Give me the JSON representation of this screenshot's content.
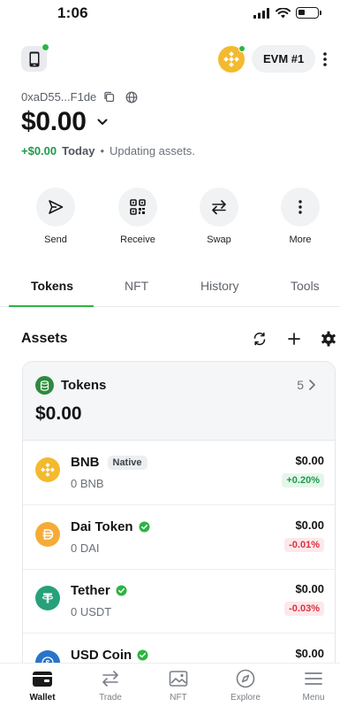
{
  "status_bar": {
    "time": "1:06"
  },
  "header": {
    "network_label": "EVM #1"
  },
  "account": {
    "address": "0xaD55...F1de",
    "balance": "$0.00",
    "change_value": "+$0.00",
    "change_period": "Today",
    "status_text": "Updating assets."
  },
  "actions": [
    {
      "label": "Send",
      "icon": "send-icon"
    },
    {
      "label": "Receive",
      "icon": "qr-code-icon"
    },
    {
      "label": "Swap",
      "icon": "swap-icon"
    },
    {
      "label": "More",
      "icon": "more-vertical-icon"
    }
  ],
  "tabs": [
    {
      "label": "Tokens",
      "active": true
    },
    {
      "label": "NFT",
      "active": false
    },
    {
      "label": "History",
      "active": false
    },
    {
      "label": "Tools",
      "active": false
    }
  ],
  "assets": {
    "title": "Assets",
    "group": {
      "title": "Tokens",
      "count": "5",
      "total": "$0.00"
    },
    "tokens": [
      {
        "name": "BNB",
        "badge": "Native",
        "amount": "0 BNB",
        "value": "$0.00",
        "change": "+0.20%",
        "trend": "up",
        "color": "#f3ba2f"
      },
      {
        "name": "Dai Token",
        "verified": true,
        "amount": "0 DAI",
        "value": "$0.00",
        "change": "-0.01%",
        "trend": "down",
        "color": "#f5ac37"
      },
      {
        "name": "Tether",
        "verified": true,
        "amount": "0 USDT",
        "value": "$0.00",
        "change": "-0.03%",
        "trend": "down",
        "color": "#26a17b"
      },
      {
        "name": "USD Coin",
        "verified": true,
        "value": "$0.00",
        "color": "#2775ca"
      }
    ]
  },
  "bottom_nav": [
    {
      "label": "Wallet",
      "icon": "wallet-icon",
      "active": true
    },
    {
      "label": "Trade",
      "icon": "trade-icon",
      "active": false
    },
    {
      "label": "NFT",
      "icon": "image-icon",
      "active": false
    },
    {
      "label": "Explore",
      "icon": "compass-icon",
      "active": false
    },
    {
      "label": "Menu",
      "icon": "menu-icon",
      "active": false
    }
  ],
  "colors": {
    "accent": "#2bb541",
    "positive": "#1e9a4a",
    "negative": "#d9333f"
  }
}
